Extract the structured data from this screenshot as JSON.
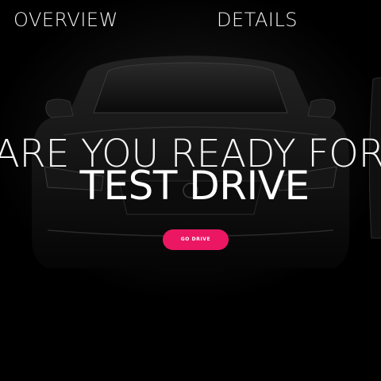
{
  "nav": {
    "tabs": [
      {
        "label": "OVERVIEW"
      },
      {
        "label": "DETAILS"
      }
    ]
  },
  "hero": {
    "headline": "ARE YOU READY FOR",
    "title": "TEST DRIVE",
    "cta_label": "GO DRIVE",
    "accent_color": "#ec1763",
    "background_image": "car-front-icon"
  }
}
